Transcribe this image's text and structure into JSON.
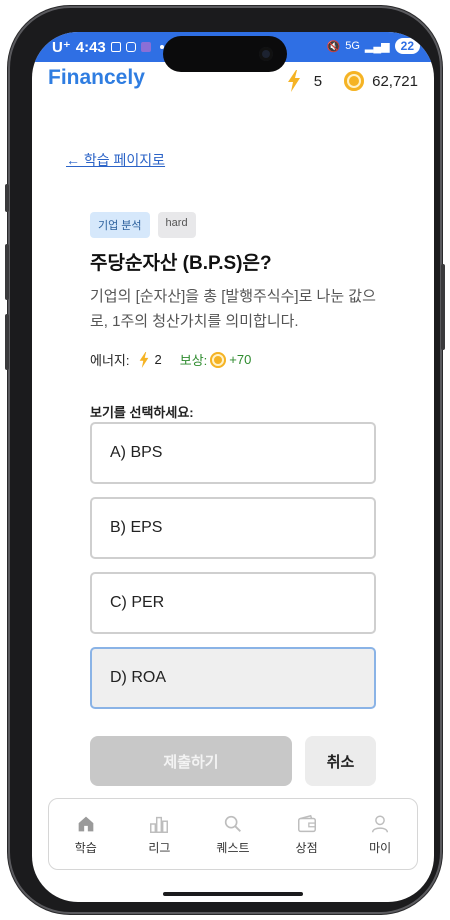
{
  "status_bar": {
    "time": "4:43",
    "carrier": "U⁺",
    "battery": "22",
    "network": "5G"
  },
  "app": {
    "brand": "Financely",
    "energy": "5",
    "coins": "62,721",
    "brand_color": "#2f7de1",
    "status_color": "#2f6fe4"
  },
  "nav": {
    "back_label": "← 학습 페이지로"
  },
  "question": {
    "category_tag": "기업 분석",
    "difficulty_tag": "hard",
    "title": "주당순자산 (B.P.S)은?",
    "description": "기업의 [순자산]을 총 [발행주식수]로 나눈 값으로, 1주의 청산가치를 의미합니다.",
    "energy_label": "에너지:",
    "energy_cost": "2",
    "reward_label": "보상:",
    "reward_value": "+70",
    "prompt": "보기를 선택하세요:"
  },
  "options": [
    {
      "label": "A) BPS"
    },
    {
      "label": "B) EPS"
    },
    {
      "label": "C) PER"
    },
    {
      "label": "D) ROA",
      "selected": true
    }
  ],
  "actions": {
    "submit": "제출하기",
    "cancel": "취소"
  },
  "tabs": [
    {
      "label": "학습",
      "icon": "home-icon"
    },
    {
      "label": "리그",
      "icon": "league-icon"
    },
    {
      "label": "퀘스트",
      "icon": "quest-search-icon"
    },
    {
      "label": "상점",
      "icon": "shop-wallet-icon"
    },
    {
      "label": "마이",
      "icon": "profile-icon"
    }
  ]
}
